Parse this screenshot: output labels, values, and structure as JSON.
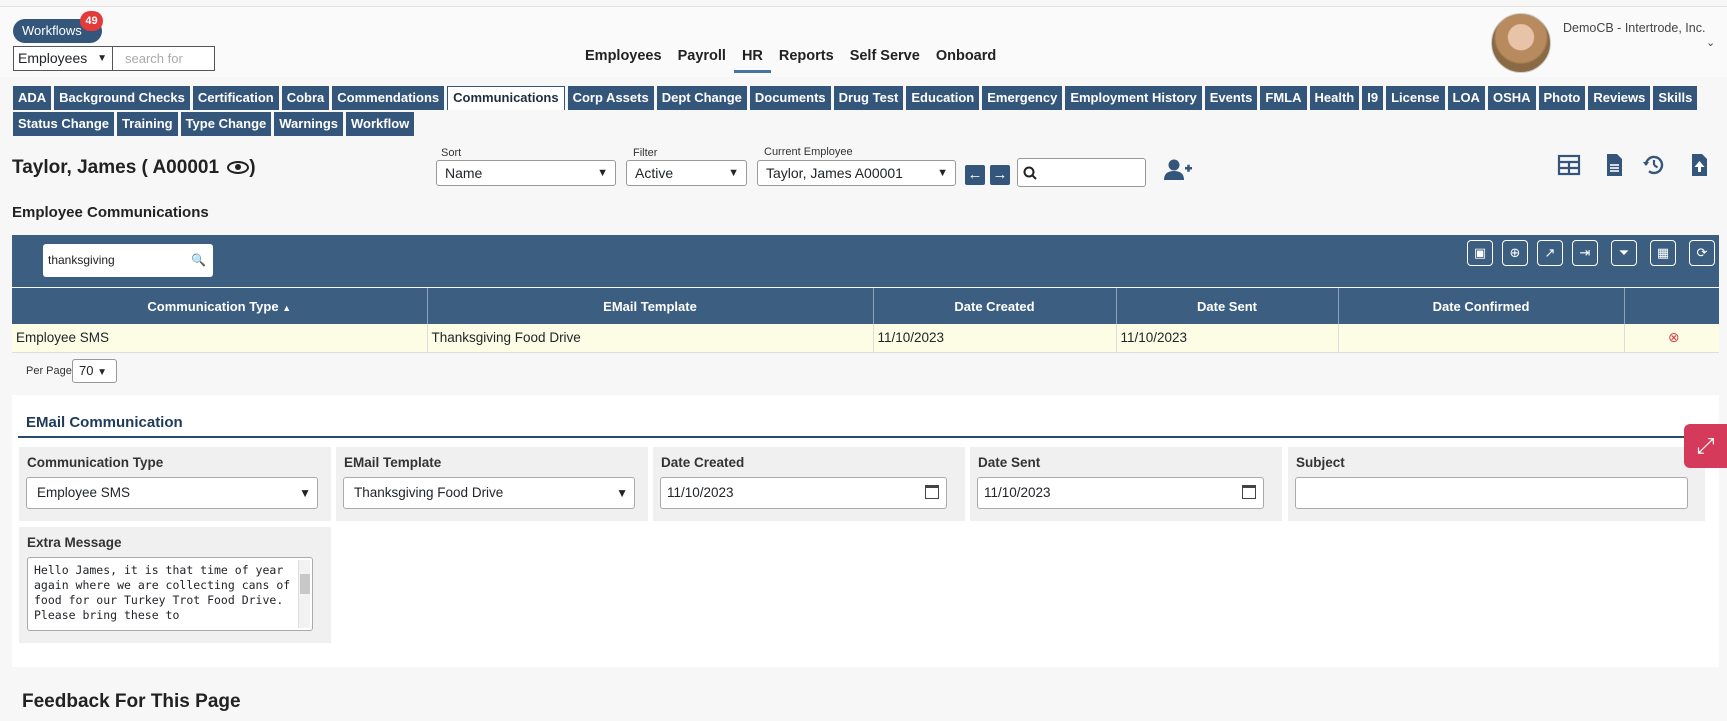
{
  "workflows": {
    "label": "Workflows",
    "count": "49"
  },
  "search": {
    "scope": "Employees",
    "placeholder": "search for"
  },
  "mainnav": [
    "Employees",
    "Payroll",
    "HR",
    "Reports",
    "Self Serve",
    "Onboard"
  ],
  "mainnav_active": "HR",
  "user": {
    "company": "DemoCB - Intertrode, Inc."
  },
  "tabs_row1": [
    "ADA",
    "Background Checks",
    "Certification",
    "Cobra",
    "Commendations",
    "Communications",
    "Corp Assets",
    "Dept Change",
    "Documents",
    "Drug Test",
    "Education",
    "Emergency",
    "Employment History",
    "Events",
    "FMLA",
    "Health",
    "I9",
    "License",
    "LOA",
    "OSHA",
    "Photo",
    "Reviews",
    "Skills"
  ],
  "tabs_row2": [
    "Status Change",
    "Training",
    "Type Change",
    "Warnings",
    "Workflow"
  ],
  "active_tab": "Communications",
  "employee": {
    "name": "Taylor, James ( A00001"
  },
  "controls": {
    "sort_label": "Sort",
    "sort_value": "Name",
    "filter_label": "Filter",
    "filter_value": "Active",
    "current_label": "Current Employee",
    "current_value": "Taylor, James A00001"
  },
  "section_title": "Employee Communications",
  "grid": {
    "search_value": "thanksgiving",
    "columns": [
      "Communication Type",
      "EMail Template",
      "Date Created",
      "Date Sent",
      "Date Confirmed"
    ],
    "sort_indicator": "▲",
    "rows": [
      {
        "type": "Employee SMS",
        "template": "Thanksgiving Food Drive",
        "created": "11/10/2023",
        "sent": "11/10/2023",
        "confirmed": ""
      }
    ],
    "per_page_label": "Per Page",
    "per_page_value": "70"
  },
  "form": {
    "title": "EMail Communication",
    "comm_type_label": "Communication Type",
    "comm_type_value": "Employee SMS",
    "template_label": "EMail Template",
    "template_value": "Thanksgiving Food Drive",
    "created_label": "Date Created",
    "created_value": "11/10/2023",
    "sent_label": "Date Sent",
    "sent_value": "11/10/2023",
    "subject_label": "Subject",
    "subject_value": "",
    "message_label": "Extra Message",
    "message_value": "Hello James, it is that time of year again where we are collecting cans of food for our Turkey Trot Food Drive.  Please bring these to"
  },
  "feedback_title": "Feedback For This Page",
  "colors": {
    "primary": "#34567a",
    "grid_header": "#3c5f81",
    "row_highlight": "#fdfde6",
    "danger": "#d9434b"
  }
}
